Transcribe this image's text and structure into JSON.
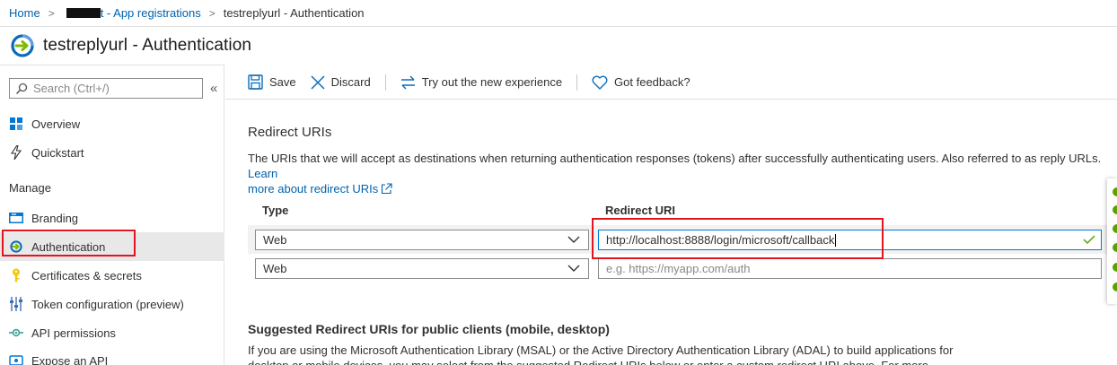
{
  "breadcrumb": {
    "home": "Home",
    "app_registrations": "t - App registrations",
    "current": "testreplyurl - Authentication"
  },
  "title": "testreplyurl - Authentication",
  "sidebar": {
    "search_placeholder": "Search (Ctrl+/)",
    "collapse_glyph": "«",
    "items_top": [
      {
        "label": "Overview",
        "icon": "overview-grid-icon"
      },
      {
        "label": "Quickstart",
        "icon": "lightning-icon"
      }
    ],
    "section_manage": "Manage",
    "items_manage": [
      {
        "label": "Branding",
        "icon": "branding-icon"
      },
      {
        "label": "Authentication",
        "icon": "authentication-icon",
        "active": true
      },
      {
        "label": "Certificates & secrets",
        "icon": "key-icon"
      },
      {
        "label": "Token configuration (preview)",
        "icon": "token-config-icon"
      },
      {
        "label": "API permissions",
        "icon": "api-permissions-icon"
      },
      {
        "label": "Expose an API",
        "icon": "expose-api-icon"
      }
    ]
  },
  "toolbar": {
    "save": "Save",
    "discard": "Discard",
    "try_new": "Try out the new experience",
    "feedback": "Got feedback?"
  },
  "redirect": {
    "heading": "Redirect URIs",
    "desc_text": "The URIs that we will accept as destinations when returning authentication responses (tokens) after successfully authenticating users. Also referred to as reply URLs. ",
    "learn_more_1": "Learn",
    "learn_more_2": "more about redirect URIs",
    "col_type": "Type",
    "col_uri": "Redirect URI",
    "rows": [
      {
        "type": "Web",
        "uri": "http://localhost:8888/login/microsoft/callback",
        "placeholder": ""
      },
      {
        "type": "Web",
        "uri": "",
        "placeholder": "e.g. https://myapp.com/auth"
      }
    ]
  },
  "suggested": {
    "heading": "Suggested Redirect URIs for public clients (mobile, desktop)",
    "para": "If you are using the Microsoft Authentication Library (MSAL) or the Active Directory Authentication Library (ADAL) to build applications for desktop or mobile devices, you may select from the suggested Redirect URIs below or enter a custom redirect URI above. For more"
  },
  "colors": {
    "link": "#0062ad",
    "highlight": "#e3141f",
    "success": "#57a300",
    "focus": "#0078d4"
  }
}
